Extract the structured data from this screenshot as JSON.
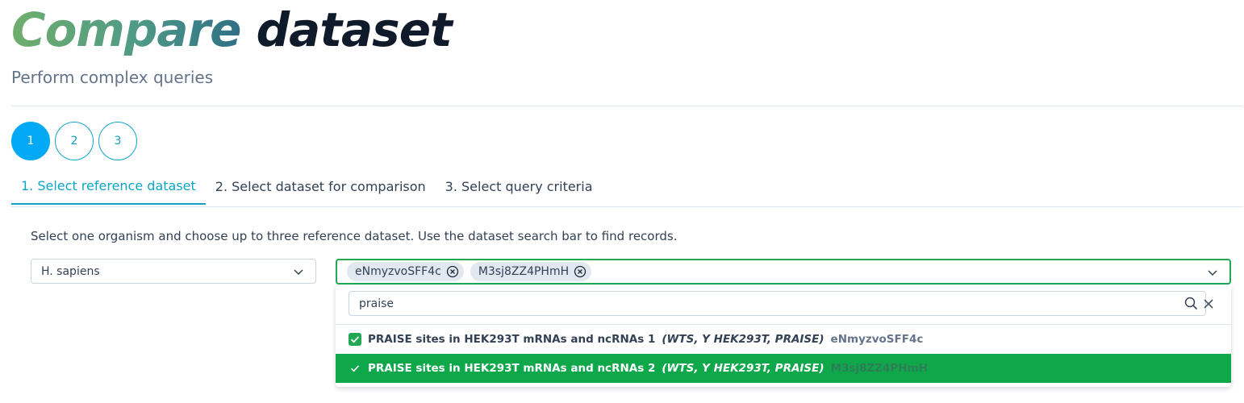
{
  "header": {
    "title_part1": "Compare",
    "title_part2": "dataset",
    "subtitle": "Perform complex queries"
  },
  "stepper": [
    "1",
    "2",
    "3"
  ],
  "tabs": [
    {
      "label": "1. Select reference dataset",
      "active": true
    },
    {
      "label": "2. Select dataset for comparison",
      "active": false
    },
    {
      "label": "3. Select query criteria",
      "active": false
    }
  ],
  "instructions": "Select one organism and choose up to three reference dataset. Use the dataset search bar to find records.",
  "organism_select": {
    "value": "H. sapiens"
  },
  "dataset_select": {
    "chips": [
      "eNmyzvoSFF4c",
      "M3sj8ZZ4PHmH"
    ],
    "filter_value": "praise",
    "options": [
      {
        "label": "PRAISE sites in HEK293T mRNAs and ncRNAs 1",
        "meta": "(WTS, Y HEK293T, PRAISE)",
        "id": "eNmyzvoSFF4c",
        "state": "checked"
      },
      {
        "label": "PRAISE sites in HEK293T mRNAs and ncRNAs 2",
        "meta": "(WTS, Y HEK293T, PRAISE)",
        "id": "M3sj8ZZ4PHmH",
        "state": "selected"
      }
    ]
  },
  "colors": {
    "accent": "#03a9f4",
    "tab_active": "#0ea5c6",
    "success": "#22a855",
    "selected_row": "#0ea84b"
  }
}
